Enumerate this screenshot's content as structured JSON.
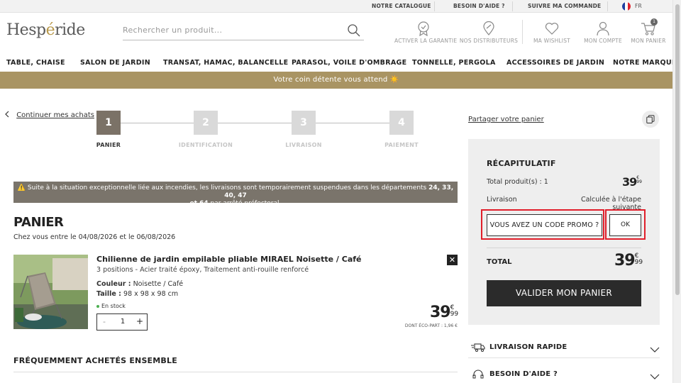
{
  "topbar": {
    "links": [
      "NOTRE CATALOGUE",
      "BESOIN D'AIDE ?",
      "SUIVRE MA COMMANDE"
    ],
    "language": "FR"
  },
  "header": {
    "logo": {
      "pre": "Hesp",
      "accent": "é",
      "post": "ride"
    },
    "search_placeholder": "Rechercher un produit...",
    "icons": [
      {
        "label": "ACTIVER LA GARANTIE",
        "icon": "warranty-badge-icon"
      },
      {
        "label": "NOS DISTRIBUTEURS",
        "icon": "location-pin-icon"
      },
      {
        "label": "MA WISHLIST",
        "icon": "heart-icon"
      },
      {
        "label": "MON COMPTE",
        "icon": "user-icon"
      },
      {
        "label": "MON PANIER",
        "icon": "cart-icon"
      }
    ],
    "cart_count": "1"
  },
  "nav": [
    "TABLE, CHAISE",
    "SALON DE JARDIN",
    "TRANSAT, HAMAC, BALANCELLE",
    "PARASOL, VOILE D'OMBRAGE",
    "TONNELLE, PERGOLA",
    "ACCESSOIRES DE JARDIN",
    "NOTRE MARQUE"
  ],
  "banner": "Votre coin détente vous attend ☀️",
  "continue_label": "Continuer mes achats",
  "steps": [
    {
      "num": "1",
      "label": "PANIER",
      "active": true
    },
    {
      "num": "2",
      "label": "IDENTIFICATION",
      "active": false
    },
    {
      "num": "3",
      "label": "LIVRAISON",
      "active": false
    },
    {
      "num": "4",
      "label": "PAIEMENT",
      "active": false
    }
  ],
  "alert": {
    "line1_pre": "⚠️ Suite à la situation exceptionnelle liée aux incendies, les livraisons sont temporairement suspendues dans les départements ",
    "line1_bold": "24, 33, 40, 47",
    "line2_bold": "et 64",
    "line2_post": " par arrêté préfectoral."
  },
  "cart": {
    "title": "PANIER",
    "delivery": "Chez vous entre le 04/08/2026 et le 06/08/2026",
    "item": {
      "name": "Chilienne de jardin empilable pliable MIRAEL Noisette / Café",
      "desc": "3 positions - Acier traité époxy, Traitement anti-rouille renforcé",
      "color_label": "Couleur :",
      "color_value": "Noisette / Café",
      "size_label": "Taille :",
      "size_value": "98 x 98 x 98 cm",
      "stock": "En stock",
      "qty_minus": "-",
      "qty": "1",
      "qty_plus": "+",
      "remove": "✕",
      "price_int": "39",
      "price_cur": "€",
      "price_cents": "99",
      "ecopart": "DONT ÉCO-PART : 1,96 €"
    },
    "freq_title": "FRÉQUEMMENT ACHETÉS ENSEMBLE"
  },
  "sidebar": {
    "share": "Partager votre panier",
    "summary_title": "RÉCAPITULATIF",
    "total_products_label": "Total produit(s) : 1",
    "total_products_int": "39",
    "total_products_cur": "€",
    "total_products_cents": "99",
    "delivery_label": "Livraison",
    "delivery_value": "Calculée à l'étape suivante",
    "promo_label": "VOUS AVEZ UN CODE PROMO ?",
    "ok_label": "OK",
    "grand_label": "TOTAL",
    "grand_int": "39",
    "grand_cur": "€",
    "grand_cents": "99",
    "validate_label": "VALIDER MON PANIER",
    "accordion": [
      "LIVRAISON RAPIDE",
      "BESOIN D'AIDE ?"
    ]
  },
  "colors": {
    "brand_gold": "#a99463",
    "dark": "#2b2b2b",
    "highlight_red": "#e01e2a",
    "step_active": "#7b7267",
    "step_inactive": "#d9d9d9"
  }
}
